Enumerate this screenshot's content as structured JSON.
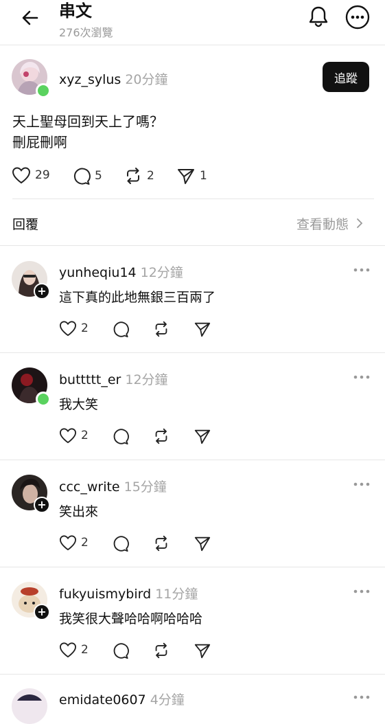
{
  "header": {
    "title": "串文",
    "views": "276次瀏覽"
  },
  "post": {
    "username": "xyz_sylus",
    "time": "20分鐘",
    "follow_label": "追蹤",
    "lines": [
      "天上聖母回到天上了嗎？",
      "刪屁刪啊"
    ],
    "likes": "29",
    "comments": "5",
    "reposts": "2",
    "shares": "1"
  },
  "replies_header": {
    "title": "回覆",
    "view_activity": "查看動態"
  },
  "replies": [
    {
      "username": "yunheqiu14",
      "time": "12分鐘",
      "text": "這下真的此地無銀三百兩了",
      "likes": "2"
    },
    {
      "username": "buttttt_er",
      "time": "12分鐘",
      "text": "我大笑",
      "likes": "2"
    },
    {
      "username": "ccc_write",
      "time": "15分鐘",
      "text": "笑出來",
      "likes": "2"
    },
    {
      "username": "fukyuismybird",
      "time": "11分鐘",
      "text": "我笑很大聲哈哈啊哈哈哈",
      "likes": "2"
    },
    {
      "username": "emidate0607",
      "time": "4分鐘"
    }
  ],
  "colors": {
    "online": "#5ad25f",
    "muted_text": "#9a9a9a",
    "follow_bg": "#111111"
  }
}
